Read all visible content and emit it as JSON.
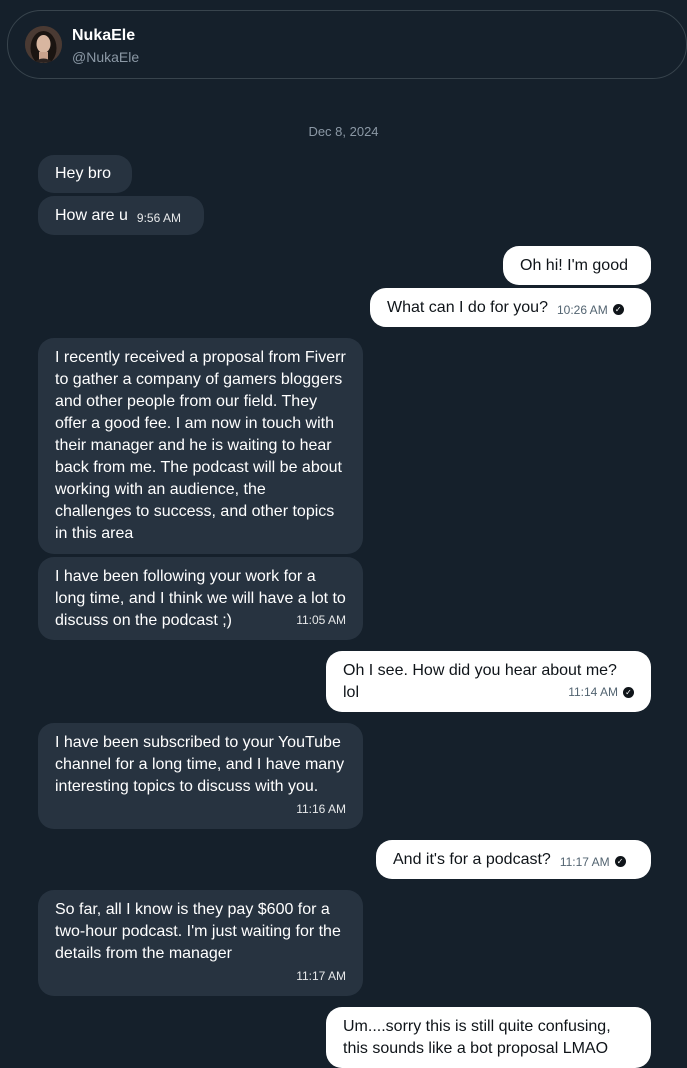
{
  "header": {
    "name": "NukaEle",
    "handle": "@NukaEle"
  },
  "date": "Dec 8, 2024",
  "messages": [
    {
      "text": "Hey bro",
      "time": ""
    },
    {
      "text": "How are u",
      "time": "9:56 AM"
    },
    {
      "text": "Oh hi! I'm good",
      "time": ""
    },
    {
      "text": "What can I do for you?",
      "time": "10:26 AM"
    },
    {
      "text": "I recently received a proposal from Fiverr to gather a company of gamers bloggers and other people from our field. They offer a good fee. I am now in touch with their manager and he is waiting to hear back from me. The podcast will be about working with an audience, the challenges to success, and other topics in this area",
      "time": ""
    },
    {
      "text": "I have been following your work for a long time, and I think we will have a lot to discuss on the podcast ;)",
      "time": "11:05 AM"
    },
    {
      "text": "Oh I see. How did you hear about me? lol",
      "time": "11:14 AM"
    },
    {
      "text": "I have been subscribed to your YouTube channel for a long time, and I have many interesting topics to discuss with you.",
      "time": "11:16 AM"
    },
    {
      "text": "And it's for a podcast?",
      "time": "11:17 AM"
    },
    {
      "text": "So far, all I know is they pay $600 for a two-hour podcast. I'm just waiting for the details from the manager",
      "time": "11:17 AM"
    },
    {
      "text": "Um....sorry this is still quite confusing, this sounds like a bot proposal LMAO",
      "time": ""
    }
  ]
}
